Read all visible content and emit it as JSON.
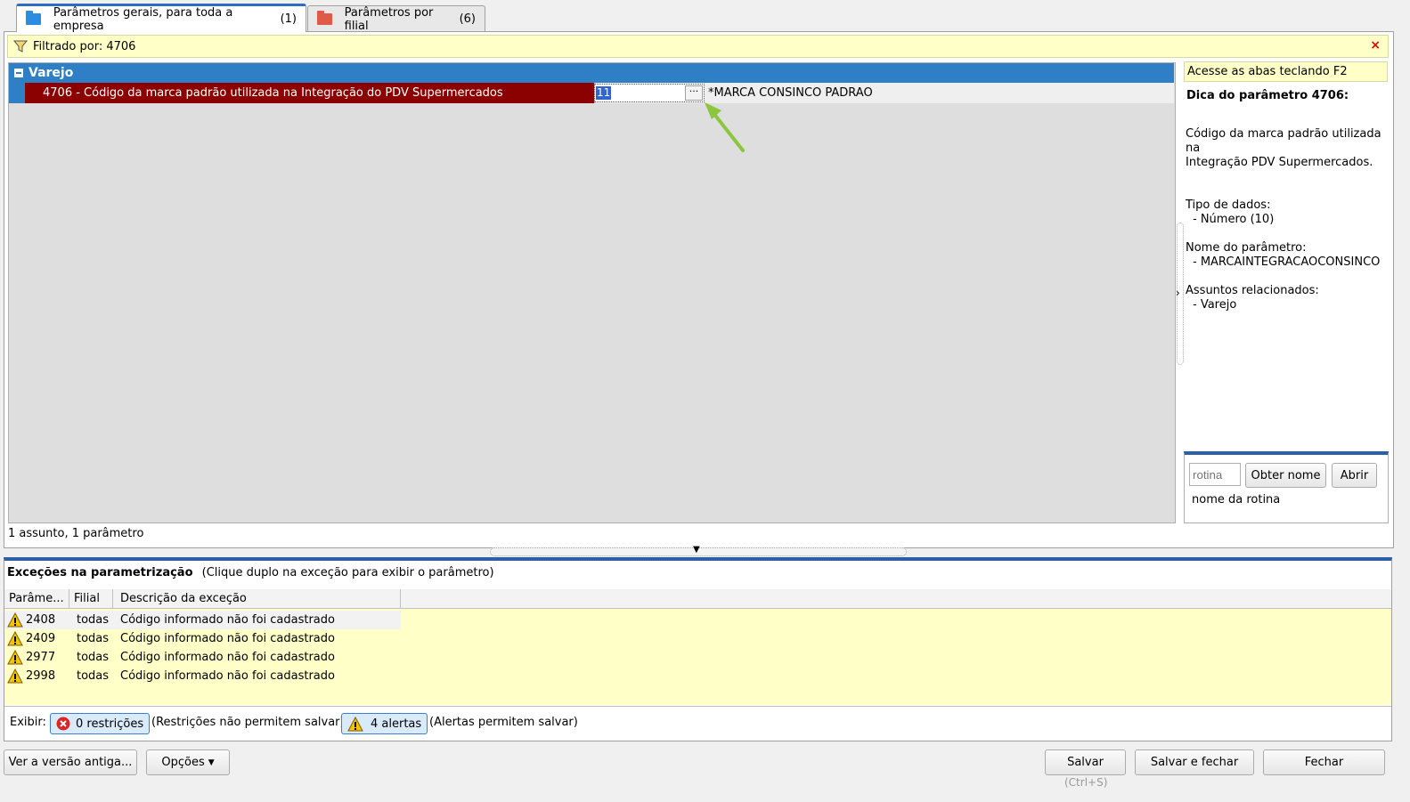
{
  "tabs": [
    {
      "label": "Parâmetros gerais, para toda a empresa",
      "count": "(1)",
      "icon": "folder-blue-icon",
      "color": "#2b8ce0"
    },
    {
      "label": "Parâmetros por filial",
      "count": "(6)",
      "icon": "folder-red-icon",
      "color": "#e05a4a"
    }
  ],
  "filter": {
    "text": "Filtrado por: 4706",
    "close": "×"
  },
  "grid": {
    "group": "Varejo",
    "param": {
      "description": "4706 - Código da marca padrão utilizada na Integração do PDV Supermercados",
      "value": "11",
      "ellipsis": "···",
      "display": "*MARCA CONSINCO PADRAO"
    },
    "status": "1 assunto, 1 parâmetro"
  },
  "side": {
    "hint": "Acesse as abas teclando F2",
    "tip_title": "Dica do parâmetro 4706:",
    "tip_lines": [
      "Código da marca padrão utilizada na",
      "Integração PDV Supermercados."
    ],
    "type_label": "Tipo de dados:",
    "type_value": "- Número (10)",
    "name_label": "Nome do parâmetro:",
    "name_value": "- MARCAINTEGRACAOCONSINCO",
    "subjects_label": "Assuntos relacionados:",
    "subjects_value": "- Varejo",
    "routine_placeholder": "rotina",
    "obter_label": "Obter nome",
    "abrir_label": "Abrir",
    "routine_name": "nome da rotina"
  },
  "exceptions": {
    "title": "Exceções na parametrização",
    "subtitle": "(Clique duplo na exceção para exibir o parâmetro)",
    "columns": [
      "Parâme...",
      "Filial",
      "Descrição da exceção"
    ],
    "rows": [
      {
        "param": "2408",
        "filial": "todas",
        "desc": "Código informado não foi cadastrado"
      },
      {
        "param": "2409",
        "filial": "todas",
        "desc": "Código informado não foi cadastrado"
      },
      {
        "param": "2977",
        "filial": "todas",
        "desc": "Código informado não foi cadastrado"
      },
      {
        "param": "2998",
        "filial": "todas",
        "desc": "Código informado não foi cadastrado"
      }
    ],
    "show_label": "Exibir:",
    "restrictions_label": "0 restrições",
    "restrictions_note": "(Restrições não permitem salvar)",
    "alerts_label": "4 alertas",
    "alerts_note": "(Alertas permitem salvar)"
  },
  "footer": {
    "old_version": "Ver a versão antiga...",
    "options": "Opções",
    "save": "Salvar",
    "save_shortcut": "(Ctrl+S)",
    "save_close": "Salvar e fechar",
    "close": "Fechar"
  }
}
